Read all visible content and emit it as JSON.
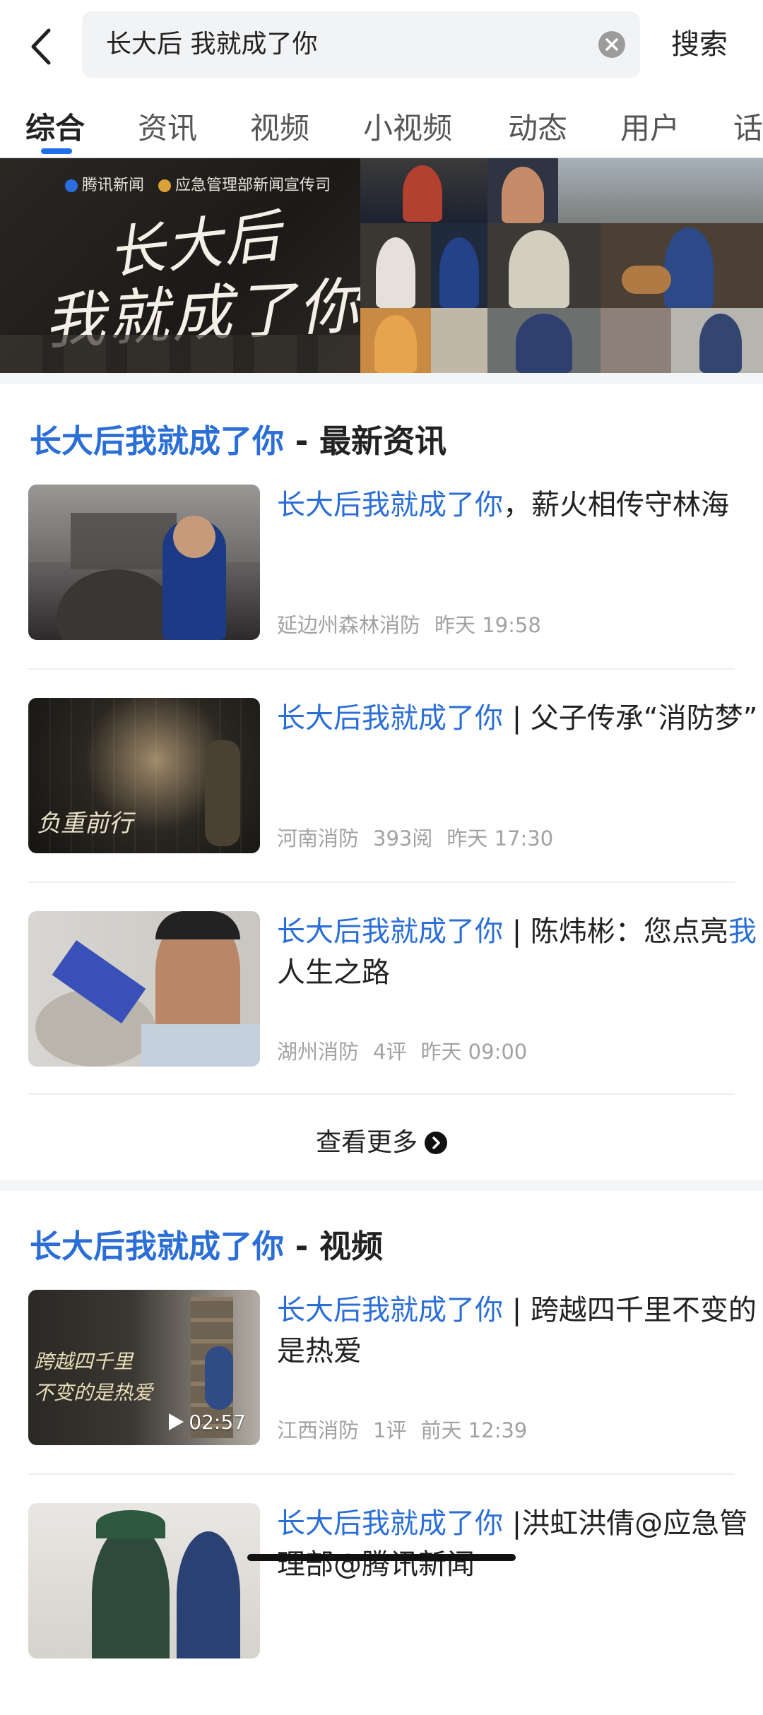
{
  "header": {
    "back_icon": "chevron-left-icon",
    "query": "长大后 我就成了你",
    "clear_icon": "clear-circle-icon",
    "search_label": "搜索"
  },
  "tabs": [
    {
      "label": "综合",
      "active": true
    },
    {
      "label": "资讯"
    },
    {
      "label": "视频"
    },
    {
      "label": "小视频"
    },
    {
      "label": "动态"
    },
    {
      "label": "用户"
    },
    {
      "label": "话"
    }
  ],
  "banner": {
    "logo_1": "腾讯新闻",
    "logo_2": "应急管理部新闻宣传司",
    "title_line1": "长大后",
    "title_line2": "我就成了你"
  },
  "news_section": {
    "title_highlight": "长大后我就成了你",
    "title_rest": " - 最新资讯",
    "items": [
      {
        "title_highlight": "长大后我就成了你",
        "title_rest": "，薪火相传守林海",
        "source": "延边州森林消防",
        "reads": "",
        "time": "昨天 19:58"
      },
      {
        "title_highlight": "长大后我就成了你",
        "title_rest": " | 父子传承“消防梦”",
        "source": "河南消防",
        "reads": "393阅",
        "time": "昨天 17:30"
      },
      {
        "title_highlight": "长大后我就成了你",
        "title_rest_1": " | 陈炜彬：您点亮",
        "title_highlight_2": "我",
        "title_rest_2": "人生之路",
        "source": "湖州消防",
        "reads": "4评",
        "time": "昨天 09:00"
      }
    ],
    "more_label": "查看更多"
  },
  "video_section": {
    "title_highlight": "长大后我就成了你",
    "title_rest": " - 视频",
    "items": [
      {
        "title_highlight": "长大后我就成了你",
        "title_rest": " | 跨越四千里不变的是热爱",
        "source": "江西消防",
        "reads": "1评",
        "time": "前天 12:39",
        "duration": "02:57"
      },
      {
        "title_highlight": "长大后我就成了你",
        "title_rest": " |洪虹洪倩@应急管理部@腾讯新闻"
      }
    ]
  },
  "colors": {
    "accent": "#2a6ed6",
    "tab_indicator": "#1e6fe8",
    "meta_text": "#a2a2a2",
    "section_gap": "#f4f5f6"
  }
}
